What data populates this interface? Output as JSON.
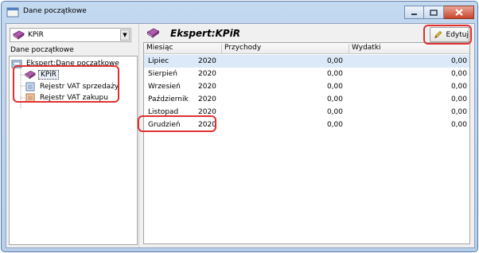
{
  "window": {
    "title": "Dane początkowe"
  },
  "left": {
    "combo_value": "KPiR",
    "section_label": "Dane początkowe",
    "tree": [
      {
        "label": "Ekspert:Dane początkowe",
        "icon": "folder-icon"
      },
      {
        "label": "KPiR",
        "icon": "book-icon",
        "selected": true
      },
      {
        "label": "Rejestr VAT sprzedaży",
        "icon": "register-icon"
      },
      {
        "label": "Rejestr VAT zakupu",
        "icon": "register-icon"
      }
    ]
  },
  "right": {
    "title": "Ekspert:KPiR",
    "edit_label": "Edytuj",
    "columns": [
      "Miesiąc",
      "Przychody",
      "Wydatki"
    ],
    "rows": [
      {
        "month": "Lipiec",
        "year": "2020",
        "income": "0,00",
        "expense": "0,00"
      },
      {
        "month": "Sierpień",
        "year": "2020",
        "income": "0,00",
        "expense": "0,00"
      },
      {
        "month": "Wrzesień",
        "year": "2020",
        "income": "0,00",
        "expense": "0,00"
      },
      {
        "month": "Październik",
        "year": "2020",
        "income": "0,00",
        "expense": "0,00"
      },
      {
        "month": "Listopad",
        "year": "2020",
        "income": "0,00",
        "expense": "0,00"
      },
      {
        "month": "Grudzień",
        "year": "2020",
        "income": "0,00",
        "expense": "0,00"
      }
    ]
  },
  "colors": {
    "highlight": "#e03030",
    "selection": "#dce9f8",
    "frame": "#b7cfe9"
  }
}
